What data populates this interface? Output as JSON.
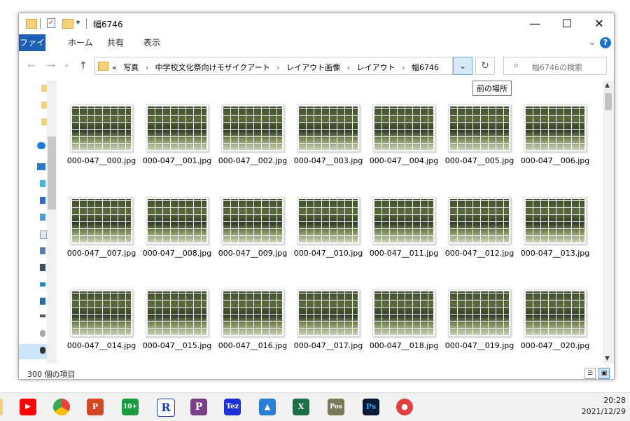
{
  "window": {
    "title": "幅6746",
    "minimize": "—",
    "maximize": "☐",
    "close": "✕"
  },
  "ribbon": {
    "tabs": [
      "ファイル",
      "ホーム",
      "共有",
      "表示"
    ],
    "collapse": "⌄",
    "help": "?"
  },
  "address": {
    "overflow": "«",
    "crumbs": [
      "写真",
      "中学校文化祭向けモザイクアート",
      "レイアウト画像",
      "レイアウト",
      "幅6746"
    ],
    "separator": "›",
    "dropdown": "⌄",
    "refresh": "↻"
  },
  "search": {
    "placeholder": "幅6746の検索",
    "icon": "search-icon"
  },
  "tooltip": "前の場所",
  "files": [
    "000-047__000.jpg",
    "000-047__001.jpg",
    "000-047__002.jpg",
    "000-047__003.jpg",
    "000-047__004.jpg",
    "000-047__005.jpg",
    "000-047__006.jpg",
    "000-047__007.jpg",
    "000-047__008.jpg",
    "000-047__009.jpg",
    "000-047__010.jpg",
    "000-047__011.jpg",
    "000-047__012.jpg",
    "000-047__013.jpg",
    "000-047__014.jpg",
    "000-047__015.jpg",
    "000-047__016.jpg",
    "000-047__017.jpg",
    "000-047__018.jpg",
    "000-047__019.jpg",
    "000-047__020.jpg"
  ],
  "status": {
    "item_count": "300 個の項目"
  },
  "taskbar": {
    "apps": [
      "youtube-icon",
      "chrome-icon",
      "powerpoint-icon",
      "app-10plus-icon",
      "r-icon",
      "p-icon",
      "tez-icon",
      "photos-icon",
      "excel-icon",
      "pos-icon",
      "photoshop-icon",
      "camera-icon"
    ],
    "time": "20:28",
    "date": "2021/12/29"
  },
  "colors": {
    "accent": "#1a5fb4",
    "selection": "#cce4f7"
  }
}
